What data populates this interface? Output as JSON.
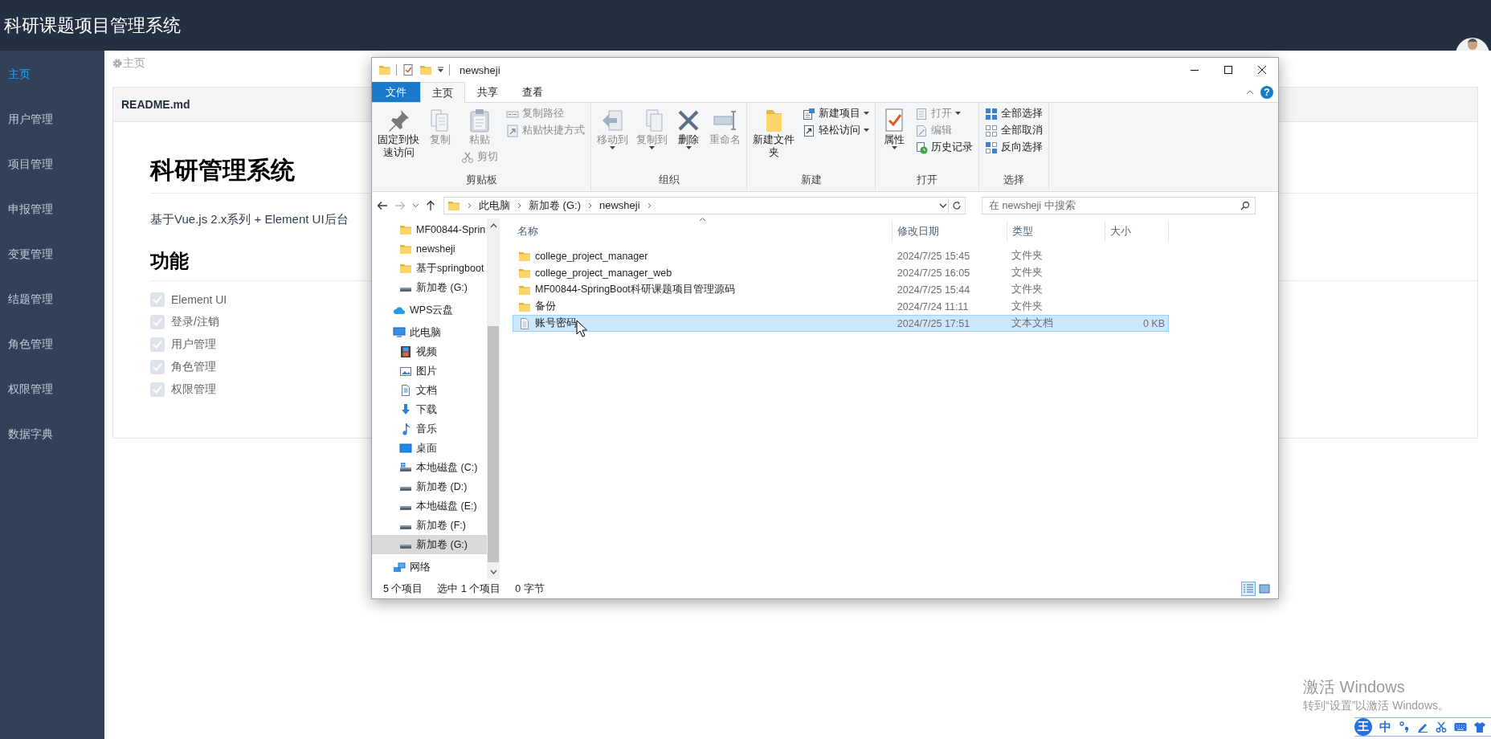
{
  "app": {
    "title": "科研课题项目管理系统"
  },
  "sidebar": {
    "items": [
      {
        "label": "主页",
        "selected": true
      },
      {
        "label": "用户管理",
        "selected": false
      },
      {
        "label": "项目管理",
        "selected": false
      },
      {
        "label": "申报管理",
        "selected": false
      },
      {
        "label": "变更管理",
        "selected": false
      },
      {
        "label": "结题管理",
        "selected": false
      },
      {
        "label": "角色管理",
        "selected": false
      },
      {
        "label": "权限管理",
        "selected": false
      },
      {
        "label": "数据字典",
        "selected": false
      }
    ]
  },
  "breadcrumb": {
    "label": "主页"
  },
  "readme": {
    "title": "README.md",
    "heading": "科研管理系统",
    "intro": "基于Vue.js 2.x系列 + Element UI后台",
    "section": "功能",
    "features": [
      {
        "label": "Element UI",
        "checked": true
      },
      {
        "label": "登录/注销",
        "checked": true
      },
      {
        "label": "用户管理",
        "checked": true
      },
      {
        "label": "角色管理",
        "checked": true
      },
      {
        "label": "权限管理",
        "checked": true
      }
    ]
  },
  "explorer": {
    "title": "newsheji",
    "tabs": [
      {
        "label": "文件",
        "kind": "menu",
        "selected": false
      },
      {
        "label": "主页",
        "kind": "tab",
        "selected": true
      },
      {
        "label": "共享",
        "kind": "tab",
        "selected": false
      },
      {
        "label": "查看",
        "kind": "tab",
        "selected": false
      }
    ],
    "help": "?",
    "ribbon": {
      "groups": [
        {
          "label": "剪贴板",
          "columns": [
            [
              {
                "kind": "large",
                "label": "固定到快速访问",
                "disabled": false,
                "dropdown": false
              }
            ],
            [
              {
                "kind": "large",
                "label": "复制",
                "disabled": true,
                "dropdown": false
              }
            ],
            [
              {
                "kind": "large",
                "label": "粘贴",
                "disabled": true,
                "dropdown": false
              },
              {
                "kind": "small",
                "label": "剪切",
                "disabled": true,
                "dropdown": false
              }
            ],
            [
              {
                "kind": "small",
                "label": "复制路径",
                "disabled": true,
                "dropdown": false
              },
              {
                "kind": "small",
                "label": "粘贴快捷方式",
                "disabled": true,
                "dropdown": false
              }
            ]
          ]
        },
        {
          "label": "组织",
          "columns": [
            [
              {
                "kind": "large",
                "label": "移动到",
                "disabled": true,
                "dropdown": true
              }
            ],
            [
              {
                "kind": "large",
                "label": "复制到",
                "disabled": true,
                "dropdown": true
              }
            ],
            [
              {
                "kind": "large",
                "label": "删除",
                "disabled": false,
                "dropdown": true
              }
            ],
            [
              {
                "kind": "large",
                "label": "重命名",
                "disabled": true,
                "dropdown": false
              }
            ]
          ]
        },
        {
          "label": "新建",
          "columns": [
            [
              {
                "kind": "large",
                "label": "新建文件夹",
                "disabled": false,
                "dropdown": false
              }
            ],
            [
              {
                "kind": "small",
                "label": "新建项目",
                "disabled": false,
                "dropdown": true
              },
              {
                "kind": "small",
                "label": "轻松访问",
                "disabled": false,
                "dropdown": true
              }
            ]
          ]
        },
        {
          "label": "打开",
          "columns": [
            [
              {
                "kind": "large",
                "label": "属性",
                "disabled": false,
                "dropdown": true
              }
            ],
            [
              {
                "kind": "small",
                "label": "打开",
                "disabled": true,
                "dropdown": true
              },
              {
                "kind": "small",
                "label": "编辑",
                "disabled": true,
                "dropdown": false
              },
              {
                "kind": "small",
                "label": "历史记录",
                "disabled": false,
                "dropdown": false
              }
            ]
          ]
        },
        {
          "label": "选择",
          "columns": [
            [
              {
                "kind": "small",
                "label": "全部选择",
                "disabled": false,
                "dropdown": false
              },
              {
                "kind": "small",
                "label": "全部取消",
                "disabled": false,
                "dropdown": false
              },
              {
                "kind": "small",
                "label": "反向选择",
                "disabled": false,
                "dropdown": false
              }
            ]
          ]
        }
      ]
    },
    "address": {
      "crumbs": [
        "此电脑",
        "新加卷 (G:)",
        "newsheji"
      ]
    },
    "search": {
      "placeholder": "在 newsheji 中搜索"
    },
    "nav": {
      "quick_access": [
        {
          "label": "MF00844-Sprin",
          "kind": "folder",
          "selected": false
        },
        {
          "label": "newsheji",
          "kind": "folder",
          "selected": false
        },
        {
          "label": "基于springboot",
          "kind": "folder",
          "selected": false
        },
        {
          "label": "新加卷 (G:)",
          "kind": "drive",
          "selected": false
        }
      ],
      "items": [
        {
          "label": "WPS云盘",
          "kind": "cloud",
          "selected": false
        },
        {
          "label": "此电脑",
          "kind": "computer",
          "selected": false,
          "children": [
            {
              "label": "视频",
              "kind": "video",
              "selected": false
            },
            {
              "label": "图片",
              "kind": "pictures",
              "selected": false
            },
            {
              "label": "文档",
              "kind": "documents",
              "selected": false
            },
            {
              "label": "下载",
              "kind": "downloads",
              "selected": false
            },
            {
              "label": "音乐",
              "kind": "music",
              "selected": false
            },
            {
              "label": "桌面",
              "kind": "desktop",
              "selected": false
            },
            {
              "label": "本地磁盘 (C:)",
              "kind": "system_drive",
              "selected": false
            },
            {
              "label": "新加卷 (D:)",
              "kind": "drive",
              "selected": false
            },
            {
              "label": "本地磁盘 (E:)",
              "kind": "drive",
              "selected": false
            },
            {
              "label": "新加卷 (F:)",
              "kind": "drive",
              "selected": false
            },
            {
              "label": "新加卷 (G:)",
              "kind": "drive",
              "selected": true
            }
          ]
        },
        {
          "label": "网络",
          "kind": "network",
          "selected": false
        }
      ]
    },
    "files": {
      "columns": [
        {
          "label": "名称",
          "sorted": true
        },
        {
          "label": "修改日期",
          "sorted": false
        },
        {
          "label": "类型",
          "sorted": false
        },
        {
          "label": "大小",
          "sorted": false
        }
      ],
      "rows": [
        {
          "name": "college_project_manager",
          "date": "2024/7/25 15:45",
          "type": "文件夹",
          "kind": "folder",
          "selected": false
        },
        {
          "name": "college_project_manager_web",
          "date": "2024/7/25 16:05",
          "type": "文件夹",
          "kind": "folder",
          "selected": false
        },
        {
          "name": "MF00844-SpringBoot科研课题项目管理源码",
          "date": "2024/7/25 15:44",
          "type": "文件夹",
          "kind": "folder",
          "selected": false
        },
        {
          "name": "备份",
          "date": "2024/7/24 11:11",
          "type": "文件夹",
          "kind": "folder",
          "selected": false
        },
        {
          "name": "账号密码",
          "date": "2024/7/25 17:51",
          "type": "文本文档",
          "size": "0 KB",
          "kind": "text",
          "selected": true
        }
      ]
    },
    "status": {
      "count": "5 个项目",
      "selection": "选中 1 个项目",
      "size": "0 字节"
    },
    "view_buttons": [
      {
        "kind": "details",
        "selected": true
      },
      {
        "kind": "large_icons",
        "selected": false
      }
    ]
  },
  "activation": {
    "title": "激活 Windows",
    "message": "转到“设置”以激活 Windows。"
  },
  "ime_bar": {
    "logo": "王",
    "mode": "中"
  }
}
